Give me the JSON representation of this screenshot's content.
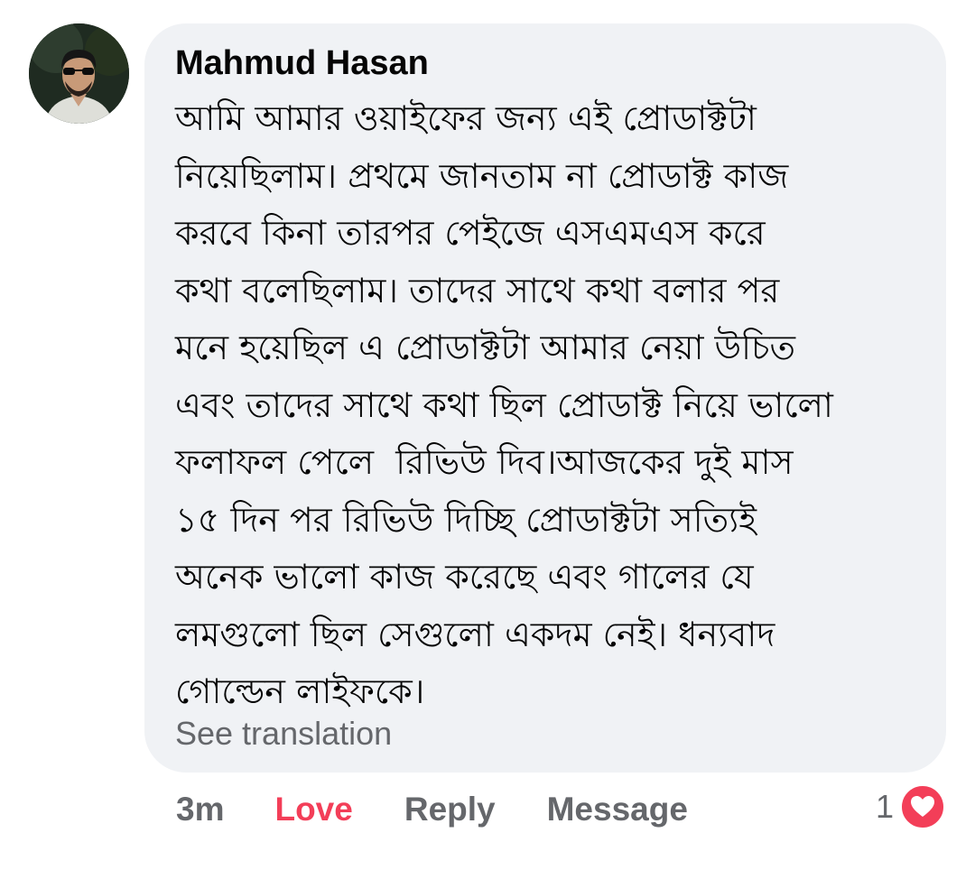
{
  "comment": {
    "author": "Mahmud Hasan",
    "lines": [
      "আমি আমার ওয়াইফের জন্য এই প্রোডাক্টটা",
      "নিয়েছিলাম। প্রথমে জানতাম না প্রোডাক্ট কাজ",
      "করবে কিনা তারপর পেইজে এসএমএস করে",
      "কথা বলেছিলাম। তাদের সাথে কথা বলার পর",
      "মনে হয়েছিল এ প্রোডাক্টটা আমার নেয়া উচিত",
      "এবং তাদের সাথে কথা ছিল প্রোডাক্ট নিয়ে ভালো",
      "ফলাফল পেলে  রিভিউ দিব।আজকের দুই মাস",
      "১৫ দিন পর রিভিউ দিচ্ছি প্রোডাক্টটা সত্যিই",
      "অনেক ভালো কাজ করেছে এবং গালের যে",
      "লমগুলো ছিল সেগুলো একদম নেই। ধন্যবাদ",
      "গোল্ডেন লাইফকে।"
    ],
    "see_translation": "See translation"
  },
  "actions": {
    "time": "3m",
    "love": "Love",
    "reply": "Reply",
    "message": "Message"
  },
  "reaction": {
    "count": "1",
    "icon": "heart-icon"
  },
  "colors": {
    "bubble_bg": "#f0f2f5",
    "love_red": "#f33e58",
    "secondary_text": "#65676b",
    "primary_text": "#050505"
  }
}
